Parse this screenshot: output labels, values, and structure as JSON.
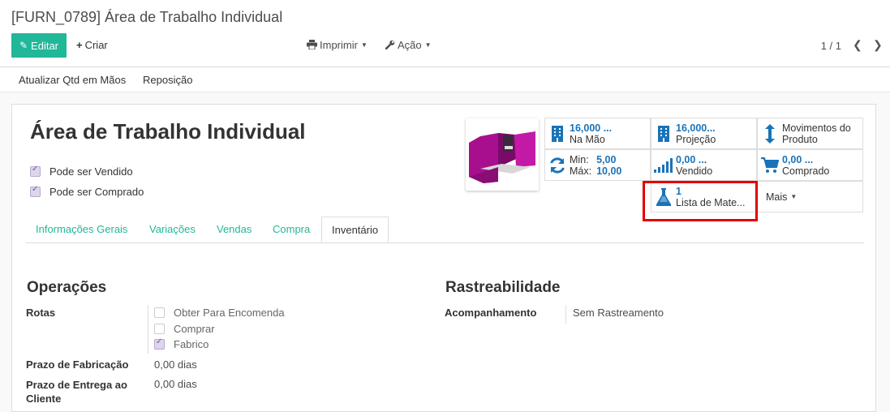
{
  "breadcrumb": "[FURN_0789] Área de Trabalho Individual",
  "toolbar": {
    "edit": "Editar",
    "create": "Criar",
    "print": "Imprimir",
    "action": "Ação"
  },
  "pager": {
    "value": "1 / 1"
  },
  "statusbar": {
    "update_qty": "Atualizar Qtd em Mãos",
    "replenish": "Reposição"
  },
  "product": {
    "name": "Área de Trabalho Individual",
    "can_be_sold": "Pode ser Vendido",
    "can_be_purchased": "Pode ser Comprado"
  },
  "smart_buttons": {
    "on_hand": {
      "value": "16,000 ...",
      "label": "Na Mão"
    },
    "forecast": {
      "value": "16,000...",
      "label": "Projeção"
    },
    "moves": {
      "line1": "Movimentos do",
      "line2": "Produto"
    },
    "minmax": {
      "min_label": "Min:",
      "min": "5,00",
      "max_label": "Máx:",
      "max": "10,00"
    },
    "sold": {
      "value": "0,00 ...",
      "label": "Vendido"
    },
    "purchased": {
      "value": "0,00 ...",
      "label": "Comprado"
    },
    "bom": {
      "value": "1",
      "label": "Lista de Mate..."
    },
    "more": "Mais"
  },
  "tabs": [
    "Informações Gerais",
    "Variações",
    "Vendas",
    "Compra",
    "Inventário"
  ],
  "operations": {
    "title": "Operações",
    "routes_label": "Rotas",
    "routes": [
      "Obter Para Encomenda",
      "Comprar",
      "Fabrico"
    ],
    "mfg_lead_label": "Prazo de Fabricação",
    "mfg_lead": "0,00 dias",
    "customer_lead_label": "Prazo de Entrega ao Cliente",
    "customer_lead": "0,00 dias"
  },
  "traceability": {
    "title": "Rastreabilidade",
    "tracking_label": "Acompanhamento",
    "tracking": "Sem Rastreamento"
  },
  "colors": {
    "accent": "#21b799",
    "link_blue": "#1a73b8",
    "highlight": "#e30000"
  }
}
